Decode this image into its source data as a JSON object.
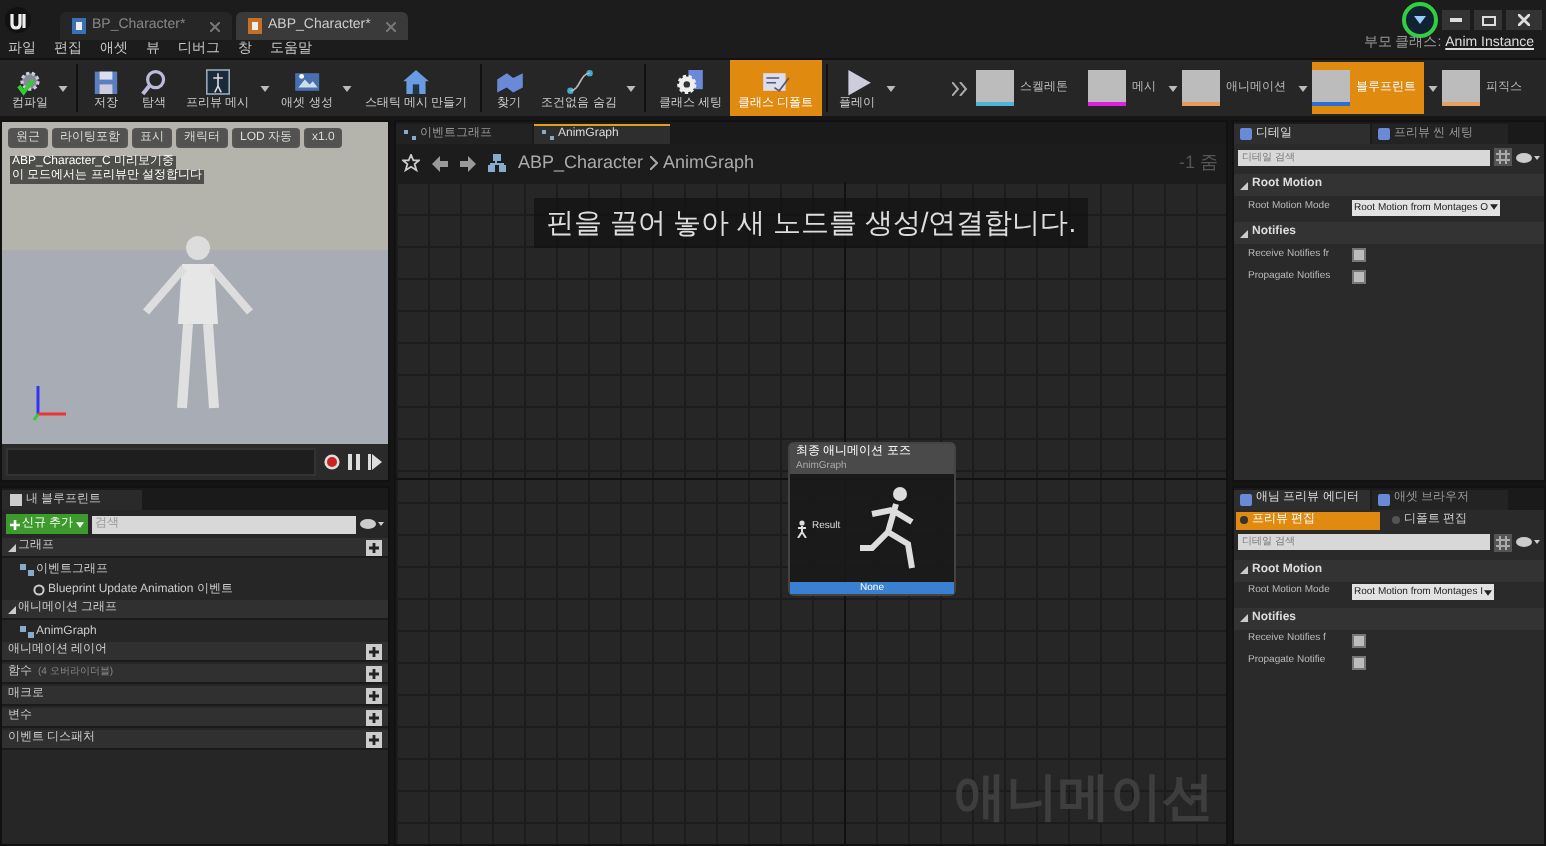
{
  "window": {
    "doc_tabs": [
      {
        "label": "BP_Character*",
        "selected": false
      },
      {
        "label": "ABP_Character*",
        "selected": true
      }
    ]
  },
  "menu": [
    "파일",
    "편집",
    "애셋",
    "뷰",
    "디버그",
    "창",
    "도움말"
  ],
  "parent_class": {
    "label": "부모 클래스:",
    "value": "Anim Instance"
  },
  "toolbar": [
    {
      "label": "컴파일",
      "kind": "compile",
      "dropdown": true,
      "active": false
    },
    {
      "label": "저장",
      "kind": "save",
      "dropdown": false,
      "active": false
    },
    {
      "label": "탐색",
      "kind": "browse",
      "dropdown": false,
      "active": false
    },
    {
      "label": "프리뷰 메시",
      "kind": "mesh",
      "dropdown": true,
      "active": false
    },
    {
      "label": "애셋 생성",
      "kind": "asset",
      "dropdown": true,
      "active": false
    },
    {
      "label": "스태틱 메시 만들기",
      "kind": "static",
      "dropdown": false,
      "active": false
    },
    {
      "label": "찾기",
      "kind": "find",
      "dropdown": false,
      "active": false
    },
    {
      "label": "조건없음 숨김",
      "kind": "pins",
      "dropdown": true,
      "active": false
    },
    {
      "label": "클래스 세팅",
      "kind": "settings",
      "dropdown": false,
      "active": false
    },
    {
      "label": "클래스 디폴트",
      "kind": "defaults",
      "dropdown": false,
      "active": true
    },
    {
      "label": "플레이",
      "kind": "play",
      "dropdown": true,
      "active": false
    }
  ],
  "modes": [
    {
      "label": "스켈레톤",
      "color": "#4fb3d9",
      "dropdown": false,
      "selected": false
    },
    {
      "label": "메시",
      "color": "#e020e0",
      "dropdown": true,
      "selected": false
    },
    {
      "label": "애니메이션",
      "color": "#e89a5a",
      "dropdown": true,
      "selected": false
    },
    {
      "label": "블루프린트",
      "color": "#2a6fd6",
      "dropdown": true,
      "selected": true
    },
    {
      "label": "피직스",
      "color": "#e8a060",
      "dropdown": false,
      "selected": false
    }
  ],
  "viewport": {
    "buttons": [
      "원근",
      "라이팅포함",
      "표시",
      "캐릭터",
      "LOD 자동",
      "x1.0"
    ],
    "info": [
      "ABP_Character_C 미리보기중",
      "이 모드에서는 프리뷰만 설정합니다"
    ]
  },
  "my_blueprint": {
    "tab": "내 블루프린트",
    "add_button": "신규 추가",
    "search": {
      "placeholder": "검색"
    },
    "sections": [
      {
        "label": "그래프",
        "addable": true,
        "children": [
          {
            "label": "이벤트그래프",
            "children": [
              {
                "label": "Blueprint Update Animation 이벤트"
              }
            ]
          }
        ]
      },
      {
        "label": "애니메이션 그래프",
        "addable": false,
        "children": [
          {
            "label": "AnimGraph"
          }
        ]
      },
      {
        "label": "애니메이션 레이어",
        "addable": true
      },
      {
        "label": "함수",
        "note": "(4 오버라이더블)",
        "addable": true
      },
      {
        "label": "매크로",
        "addable": true
      },
      {
        "label": "변수",
        "addable": true
      },
      {
        "label": "이벤트 디스패처",
        "addable": true
      }
    ]
  },
  "graph": {
    "tabs": [
      {
        "label": "이벤트그래프",
        "selected": false
      },
      {
        "label": "AnimGraph",
        "selected": true
      }
    ],
    "breadcrumb": [
      "ABP_Character",
      "AnimGraph"
    ],
    "zoom": "-1 줌",
    "hint": "핀을 끌어 놓아 새 노드를 생성/연결합니다.",
    "node": {
      "title": "최종 애니메이션 포즈",
      "subtitle": "AnimGraph",
      "pin": "Result",
      "footer": "None"
    },
    "watermark": "애니메이션"
  },
  "details_panels": [
    {
      "tabs": [
        {
          "label": "디테일",
          "selected": true
        },
        {
          "label": "프리뷰 씬 세팅",
          "selected": false
        }
      ],
      "search": {
        "placeholder": "디테일 검색"
      },
      "sections": [
        {
          "title": "Root Motion",
          "rows": [
            {
              "kind": "dropdown",
              "label": "Root Motion Mode",
              "value": "Root Motion from Montages O"
            }
          ]
        },
        {
          "title": "Notifies",
          "rows": [
            {
              "kind": "checkbox",
              "label": "Receive Notifies fr",
              "checked": false
            },
            {
              "kind": "checkbox",
              "label": "Propagate Notifies",
              "checked": false
            }
          ]
        }
      ]
    },
    {
      "tabs": [
        {
          "label": "애님 프리뷰 에디터",
          "selected": true
        },
        {
          "label": "애셋 브라우저",
          "selected": false
        }
      ],
      "toggles": [
        {
          "label": "프리뷰 편집",
          "selected": true
        },
        {
          "label": "디폴트 편집",
          "selected": false
        }
      ],
      "search": {
        "placeholder": "디테일 검색"
      },
      "sections": [
        {
          "title": "Root Motion",
          "rows": [
            {
              "kind": "dropdown",
              "label": "Root Motion Mode",
              "value": "Root Motion from Montages I"
            }
          ]
        },
        {
          "title": "Notifies",
          "rows": [
            {
              "kind": "checkbox",
              "label": "Receive Notifies f",
              "checked": false
            },
            {
              "kind": "checkbox",
              "label": "Propagate Notifie",
              "checked": false
            }
          ]
        }
      ]
    }
  ]
}
